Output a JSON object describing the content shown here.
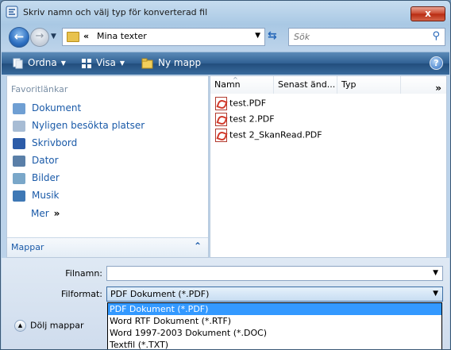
{
  "window": {
    "title": "Skriv namn och välj typ för konverterad fil",
    "close_label": "x"
  },
  "address_bar": {
    "separator": "«",
    "location": "Mina texter"
  },
  "search": {
    "placeholder": "Sök"
  },
  "toolbar": {
    "organize_label": "Ordna",
    "view_label": "Visa",
    "new_folder_label": "Ny mapp"
  },
  "nav": {
    "header": "Favoritlänkar",
    "items": [
      {
        "label": "Dokument",
        "icon": "documents-icon"
      },
      {
        "label": "Nyligen besökta platser",
        "icon": "recent-places-icon"
      },
      {
        "label": "Skrivbord",
        "icon": "desktop-icon"
      },
      {
        "label": "Dator",
        "icon": "computer-icon"
      },
      {
        "label": "Bilder",
        "icon": "pictures-icon"
      },
      {
        "label": "Musik",
        "icon": "music-icon"
      }
    ],
    "more_label": "Mer",
    "more_chevron": "»",
    "folders_label": "Mappar"
  },
  "files": {
    "columns": [
      "Namn",
      "Senast änd...",
      "Typ"
    ],
    "more": "»",
    "items": [
      "test.PDF",
      "test 2.PDF",
      "test 2_SkanRead.PDF"
    ]
  },
  "form": {
    "filename_label": "Filnamn:",
    "filename_value": "",
    "format_label": "Filformat:",
    "format_value": "PDF Dokument (*.PDF)",
    "format_options": [
      "PDF Dokument (*.PDF)",
      "Word RTF Dokument (*.RTF)",
      "Word 1997-2003 Dokument (*.DOC)",
      "Textfil (*.TXT)"
    ],
    "hide_folders_label": "Dölj mappar"
  }
}
